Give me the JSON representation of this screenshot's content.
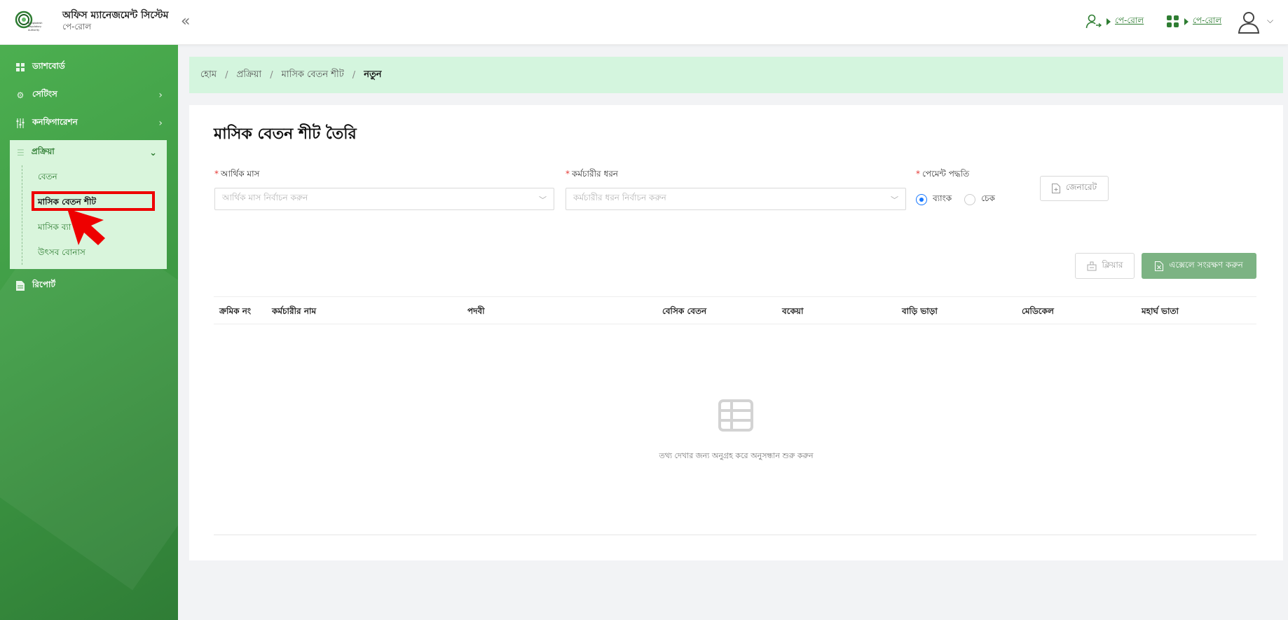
{
  "app": {
    "title": "অফিস ম্যানেজমেন্ট সিস্টেম",
    "subtitle": "পে-রোল",
    "logo_text": "Bangladesh Regulatory Authority"
  },
  "header": {
    "link1_label": "পে-রোল",
    "link2_label": "পে-রোল"
  },
  "sidebar": {
    "items": [
      {
        "label": "ড্যাশবোর্ড",
        "icon": "dashboard-icon"
      },
      {
        "label": "সেটিংস",
        "icon": "gear-icon"
      },
      {
        "label": "কনফিগারেশন",
        "icon": "sliders-icon"
      },
      {
        "label": "প্রক্রিয়া",
        "icon": "list-icon"
      },
      {
        "label": "রিপোর্ট",
        "icon": "document-icon"
      }
    ],
    "sub_items": [
      {
        "label": "বেতন"
      },
      {
        "label": "মাসিক বেতন শীট"
      },
      {
        "label": "মাসিক ব্যা"
      },
      {
        "label": "উৎসব বোনাস"
      }
    ]
  },
  "breadcrumb": {
    "items": [
      "হোম",
      "প্রক্রিয়া",
      "মাসিক বেতন শীট"
    ],
    "current": "নতুন"
  },
  "form": {
    "title": "মাসিক বেতন শীট তৈরি",
    "fiscal_month_label": "আর্থিক মাস",
    "fiscal_month_placeholder": "আর্থিক মাস নির্বাচন করুন",
    "employee_type_label": "কর্মচারীর ধরন",
    "employee_type_placeholder": "কর্মচারীর ধরন নির্বাচন করুন",
    "payment_method_label": "পেমেন্ট পদ্ধতি",
    "payment_options": [
      {
        "label": "ব্যাংক",
        "selected": true
      },
      {
        "label": "চেক",
        "selected": false
      }
    ],
    "generate_label": "জেনারেট",
    "clear_label": "ক্লিয়ার",
    "save_excel_label": "এক্সেলে সংরক্ষণ করুন"
  },
  "table": {
    "columns": [
      "ক্রমিক নং",
      "কর্মচারীর নাম",
      "পদবী",
      "বেসিক বেতন",
      "বকেয়া",
      "বাড়ি ভাড়া",
      "মেডিকেল",
      "মহার্ঘ ভাতা"
    ],
    "empty_text": "তথ্য দেখার জন্য অনুগ্রহ করে অনুসন্ধান শুরু করুন"
  },
  "colors": {
    "brand_green": "#2e7d32",
    "sidebar_green": "#43a047",
    "breadcrumb_bg": "#d4f5de",
    "save_button": "#7cb383",
    "highlight": "#ee0000"
  }
}
